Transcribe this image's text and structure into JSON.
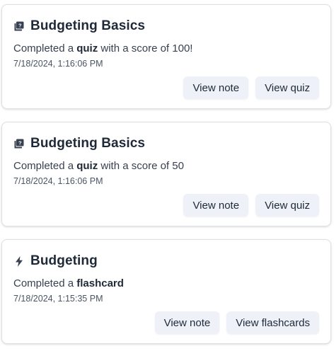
{
  "activities": [
    {
      "icon": "quiz-book-icon",
      "title": "Budgeting Basics",
      "desc_prefix": "Completed a ",
      "desc_type": "quiz",
      "desc_suffix": " with a score of 100!",
      "timestamp": "7/18/2024, 1:16:06 PM",
      "buttons": [
        "View note",
        "View quiz"
      ]
    },
    {
      "icon": "quiz-book-icon",
      "title": "Budgeting Basics",
      "desc_prefix": "Completed a ",
      "desc_type": "quiz",
      "desc_suffix": " with a score of 50",
      "timestamp": "7/18/2024, 1:16:06 PM",
      "buttons": [
        "View note",
        "View quiz"
      ]
    },
    {
      "icon": "lightning-bolt-icon",
      "title": "Budgeting",
      "desc_prefix": "Completed a ",
      "desc_type": "flashcard",
      "desc_suffix": "",
      "timestamp": "7/18/2024, 1:15:35 PM",
      "buttons": [
        "View note",
        "View flashcards"
      ]
    }
  ],
  "colors": {
    "text_dark": "#1f2937",
    "button_bg": "#eef2f8",
    "card_border": "#dde1e6"
  }
}
